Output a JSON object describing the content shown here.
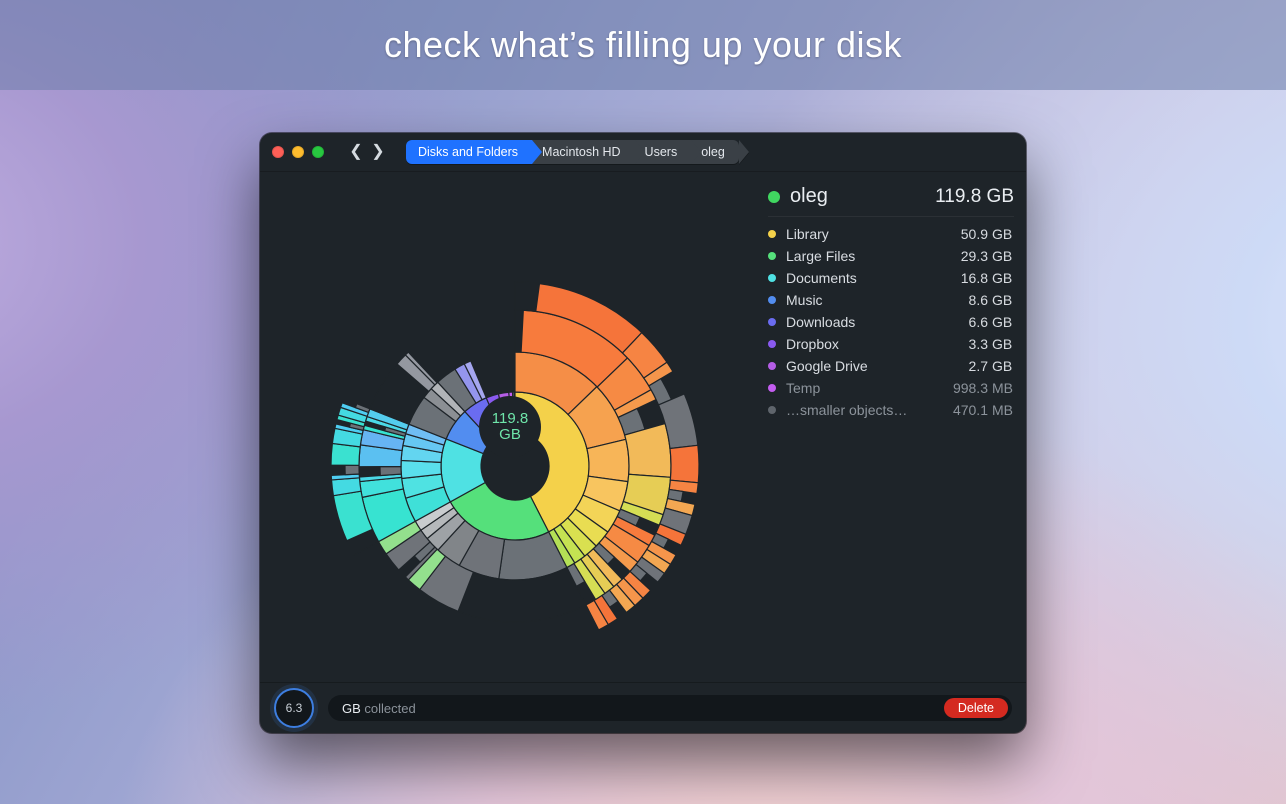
{
  "promo": {
    "headline": "check what’s filling up your disk"
  },
  "breadcrumb": {
    "items": [
      {
        "label": "Disks and Folders",
        "active": true
      },
      {
        "label": "Macintosh HD"
      },
      {
        "label": "Users"
      },
      {
        "label": "oleg"
      }
    ]
  },
  "center": {
    "value": "119.8",
    "unit": "GB"
  },
  "selection": {
    "name": "oleg",
    "size": "119.8 GB",
    "color": "#40d760"
  },
  "items": [
    {
      "name": "Library",
      "size": "50.9",
      "unit": "GB",
      "color": "#f4d14a"
    },
    {
      "name": "Large Files",
      "size": "29.3",
      "unit": "GB",
      "color": "#55e07b"
    },
    {
      "name": "Documents",
      "size": "16.8",
      "unit": "GB",
      "color": "#4fe1e3"
    },
    {
      "name": "Music",
      "size": "8.6",
      "unit": "GB",
      "color": "#528df0"
    },
    {
      "name": "Downloads",
      "size": "6.6",
      "unit": "GB",
      "color": "#6a6cf0"
    },
    {
      "name": "Dropbox",
      "size": "3.3",
      "unit": "GB",
      "color": "#8a5af0"
    },
    {
      "name": "Google Drive",
      "size": "2.7",
      "unit": "GB",
      "color": "#b55de6"
    },
    {
      "name": "Temp",
      "size": "998.3",
      "unit": "MB",
      "color": "#c35df0",
      "muted": true
    },
    {
      "name": "…smaller objects…",
      "size": "470.1",
      "unit": "MB",
      "color": "#5f656c",
      "muted": true
    }
  ],
  "footer": {
    "collected_value": "6.3",
    "collected_unit": "GB",
    "collected_word": "collected",
    "delete_label": "Delete"
  },
  "chart_data": {
    "type": "sunburst",
    "title": "oleg 119.8 GB",
    "center_label": "119.8 GB",
    "total_gb": 119.8,
    "segments": [
      {
        "name": "Library",
        "value_gb": 50.9,
        "color": "#f4d14a"
      },
      {
        "name": "Large Files",
        "value_gb": 29.3,
        "color": "#55e07b"
      },
      {
        "name": "Documents",
        "value_gb": 16.8,
        "color": "#4fe1e3"
      },
      {
        "name": "Music",
        "value_gb": 8.6,
        "color": "#528df0"
      },
      {
        "name": "Downloads",
        "value_gb": 6.6,
        "color": "#6a6cf0"
      },
      {
        "name": "Dropbox",
        "value_gb": 3.3,
        "color": "#8a5af0"
      },
      {
        "name": "Google Drive",
        "value_gb": 2.7,
        "color": "#b55de6"
      },
      {
        "name": "Temp",
        "value_gb": 0.9983,
        "color": "#c35df0"
      },
      {
        "name": "smaller objects",
        "value_gb": 0.4701,
        "color": "#5f656c"
      }
    ],
    "sublevels": [
      {
        "parent": "Library",
        "breakdown_frac": [
          0.3,
          0.2,
          0.14,
          0.1,
          0.08,
          0.06,
          0.05,
          0.04,
          0.03
        ],
        "free_frac": 0.0,
        "color_ramp": [
          "#f58e47",
          "#f6a24f",
          "#f7b558",
          "#f8c55f",
          "#f3d457",
          "#e9dd52",
          "#d9e050",
          "#c5e352",
          "#b4e056"
        ]
      },
      {
        "parent": "Large Files",
        "breakdown_frac": [
          0.4,
          0.25,
          0.15,
          0.1,
          0.1
        ],
        "free_frac": 0.4,
        "color_ramp": [
          "#6f7379",
          "#818589",
          "#9ea2a6",
          "#b5b8bb",
          "#c9cccf"
        ]
      },
      {
        "parent": "Documents",
        "breakdown_frac": [
          0.25,
          0.2,
          0.18,
          0.15,
          0.12,
          0.1
        ],
        "free_frac": 0.0,
        "color_ramp": [
          "#3fe0d8",
          "#4fe2e2",
          "#5adfec",
          "#63d5f0",
          "#66c7f2",
          "#6fbdf3"
        ]
      },
      {
        "parent": "Music",
        "breakdown_frac": [
          0.55,
          0.45
        ],
        "free_frac": 0.6,
        "color_ramp": [
          "#8b8f94",
          "#b1b4b8"
        ]
      },
      {
        "parent": "Downloads",
        "breakdown_frac": [
          0.6,
          0.4
        ],
        "free_frac": 0.55,
        "color_ramp": [
          "#9495ed",
          "#a5a6ef"
        ]
      }
    ]
  }
}
